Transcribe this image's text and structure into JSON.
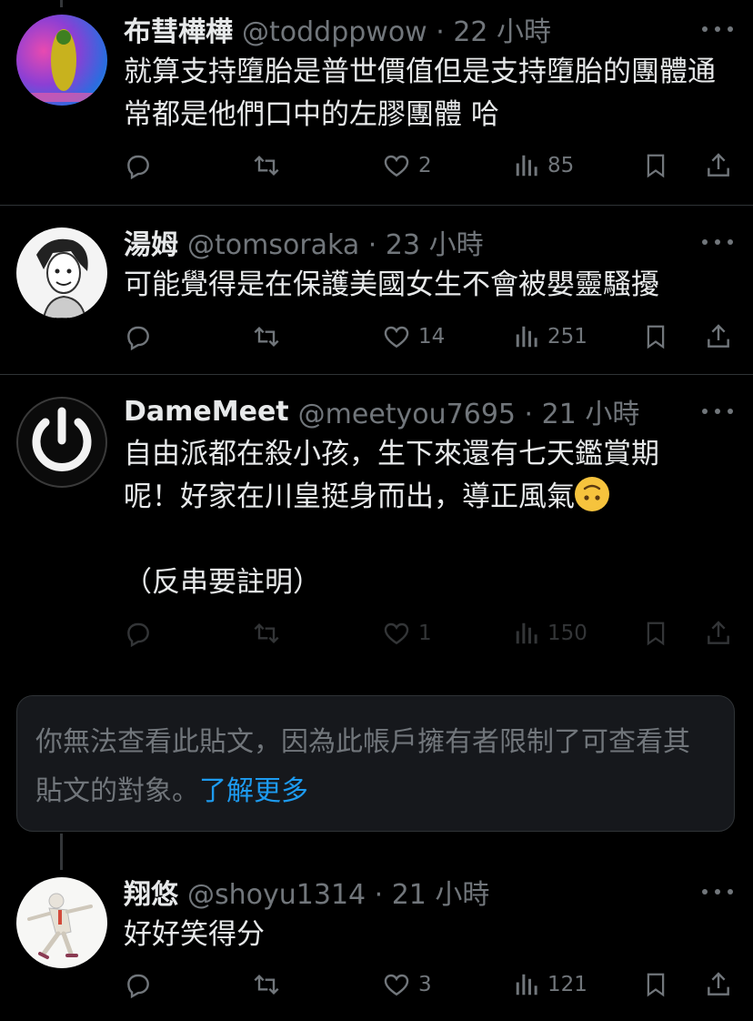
{
  "tweets": [
    {
      "name": "布彗樺樺",
      "handle": "@toddppwow · 22 小時",
      "text": "就算支持墮胎是普世價值但是支持墮胎的團體通常都是他們口中的左膠團體 哈",
      "likes": "2",
      "views": "85"
    },
    {
      "name": "湯姆",
      "handle": "@tomsoraka · 23 小時",
      "text": "可能覺得是在保護美國女生不會被嬰靈騷擾",
      "likes": "14",
      "views": "251"
    },
    {
      "name": "DameMeet",
      "handle": "@meetyou7695 · 21 小時",
      "text_line1": "自由派都在殺小孩，生下來還有七天鑑賞期",
      "text_line2": "呢！好家在川皇挺身而出，導正風氣",
      "text_line3": "（反串要註明）",
      "likes": "1",
      "views": "150"
    },
    {
      "name": "翔悠",
      "handle": "@shoyu1314 · 21 小時",
      "text": "好好笑得分",
      "likes": "3",
      "views": "121"
    }
  ],
  "restricted_notice": {
    "text": "你無法查看此貼文，因為此帳戶擁有者限制了可查看其貼文的對象。",
    "link": "了解更多"
  },
  "icons": {
    "reply": "reply-icon",
    "repost": "repost-icon",
    "like": "like-icon",
    "views": "views-icon",
    "bookmark": "bookmark-icon",
    "share": "share-icon",
    "more": "more-icon",
    "emoji": "upside-down-face-emoji"
  },
  "colors": {
    "background": "#000000",
    "text": "#e7e9ea",
    "muted": "#71767b",
    "link": "#1d9bf0"
  }
}
